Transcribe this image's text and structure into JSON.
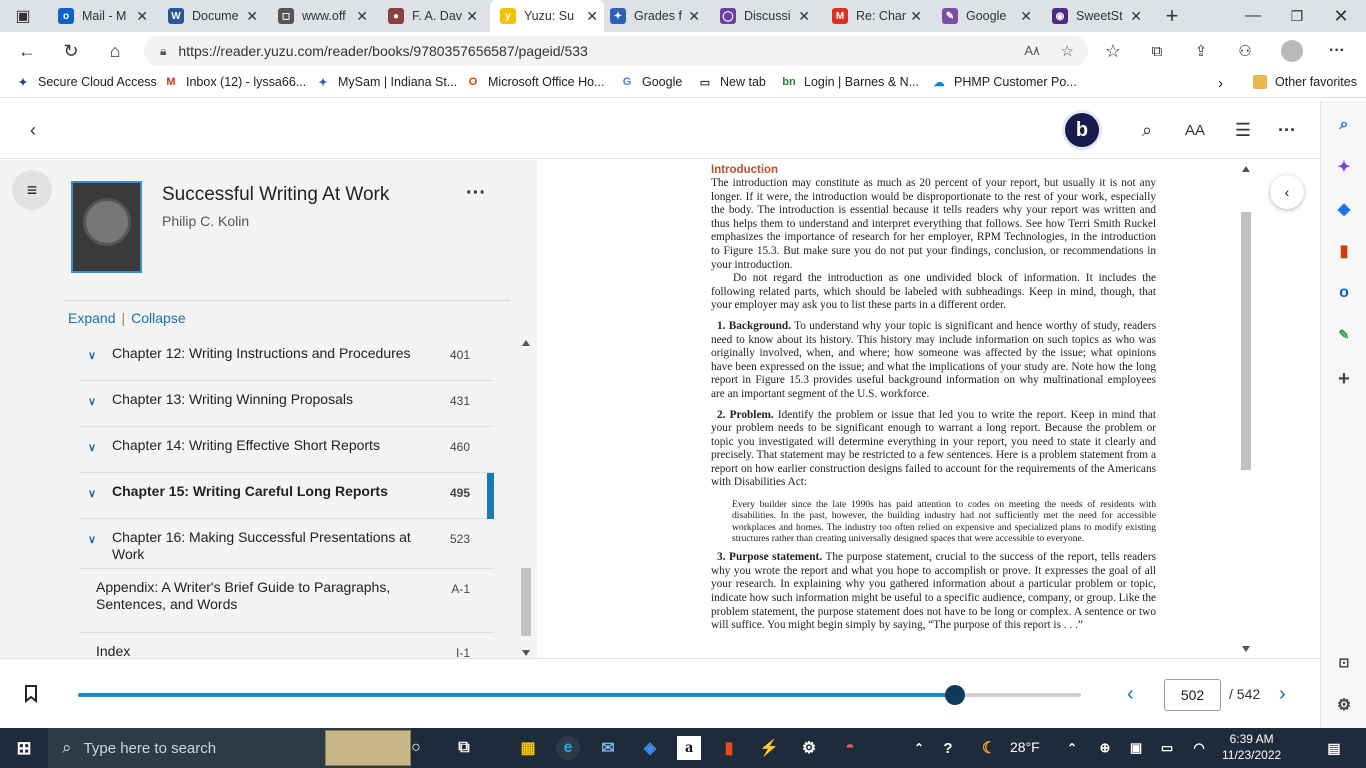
{
  "browser": {
    "tabs": [
      {
        "title": "Mail - M",
        "icon": "outlook-icon",
        "color": "#0a64c8",
        "glyph": "o"
      },
      {
        "title": "Docume",
        "icon": "word-icon",
        "color": "#2b5797",
        "glyph": "W"
      },
      {
        "title": "www.off",
        "icon": "page-icon",
        "color": "#555555",
        "glyph": "◻"
      },
      {
        "title": "F. A. Dav",
        "icon": "globe-icon",
        "color": "#8a3f3f",
        "glyph": "●"
      },
      {
        "title": "Yuzu: Su",
        "icon": "yuzu-icon",
        "color": "#f2c200",
        "glyph": "y"
      },
      {
        "title": "Grades f",
        "icon": "star-icon",
        "color": "#2e5fb8",
        "glyph": "✦"
      },
      {
        "title": "Discussi",
        "icon": "circle-icon",
        "color": "#6b3fa0",
        "glyph": "◯"
      },
      {
        "title": "Re: Char",
        "icon": "gmail-icon",
        "color": "#d93025",
        "glyph": "M"
      },
      {
        "title": "Google",
        "icon": "pen-icon",
        "color": "#7b4ea6",
        "glyph": "✎"
      },
      {
        "title": "SweetSt",
        "icon": "swirl-icon",
        "color": "#4b2a86",
        "glyph": "◉"
      }
    ],
    "active_tab_index": 4,
    "url": "https://reader.yuzu.com/reader/books/9780357656587/pageid/533",
    "favorites": [
      {
        "label": "Secure Cloud Access",
        "icon": "star-icon",
        "color": "#2e3d80",
        "glyph": "✦"
      },
      {
        "label": "Inbox (12) - lyssa66...",
        "icon": "gmail-icon",
        "color": "#d93025",
        "glyph": "M"
      },
      {
        "label": "MySam | Indiana St...",
        "icon": "star-icon",
        "color": "#2e5fb8",
        "glyph": "✦"
      },
      {
        "label": "Microsoft Office Ho...",
        "icon": "office-icon",
        "color": "#d83b01",
        "glyph": "O"
      },
      {
        "label": "Google",
        "icon": "google-icon",
        "color": "#4285f4",
        "glyph": "G"
      },
      {
        "label": "New tab",
        "icon": "newtab-icon",
        "color": "#333333",
        "glyph": "▭"
      },
      {
        "label": "Login | Barnes & N...",
        "icon": "bn-icon",
        "color": "#2e7d32",
        "glyph": "bn"
      },
      {
        "label": "PHMP Customer Po...",
        "icon": "cloud-icon",
        "color": "#0a84d8",
        "glyph": "☁"
      }
    ],
    "other_favorites": "Other favorites"
  },
  "reader": {
    "book": {
      "title": "Successful Writing At Work",
      "author": "Philip C. Kolin"
    },
    "expand_label": "Expand",
    "collapse_label": "Collapse",
    "toc": [
      {
        "label": "Chapter 12: Writing Instructions and Procedures",
        "page": "401",
        "chevron": true,
        "current": false
      },
      {
        "label": "Chapter 13: Writing Winning Proposals",
        "page": "431",
        "chevron": true,
        "current": false
      },
      {
        "label": "Chapter 14: Writing Effective Short Reports",
        "page": "460",
        "chevron": true,
        "current": false
      },
      {
        "label": "Chapter 15: Writing Careful Long Reports",
        "page": "495",
        "chevron": true,
        "current": true
      },
      {
        "label": "Chapter 16: Making Successful Presentations at Work",
        "page": "523",
        "chevron": true,
        "current": false
      },
      {
        "label": "Appendix: A Writer's Brief Guide to Paragraphs, Sentences, and Words",
        "page": "A-1",
        "chevron": false,
        "current": false
      },
      {
        "label": "Index",
        "page": "I-1",
        "chevron": false,
        "current": false
      }
    ],
    "article": {
      "heading": "Introduction",
      "p1": "The introduction may constitute as much as 20 percent of your report, but usually it is not any longer. If it were, the introduction would be disproportionate to the rest of your work, especially the body. The introduction is essential because it tells readers why your report was written and thus helps them to understand and interpret everything that follows. See how Terri Smith Ruckel emphasizes the importance of research for her employer, RPM Technologies, in the introduction to Figure 15.3. But make sure you do not put your findings, conclusion, or recommendations in your introduction.",
      "p2": "Do not regard the introduction as one undivided block of information. It includes the following related parts, which should be labeled with subheadings. Keep in mind, though, that your employer may ask you to list these parts in a different order.",
      "items": [
        {
          "lead": "1. Background.",
          "text": " To understand why your topic is significant and hence worthy of study, readers need to know about its history. This history may include information on such topics as who was originally involved, when, and where; how someone was affected by the issue; what opinions have been expressed on the issue; and what the implications of your study are. Note how the long report in Figure 15.3 provides useful background information on why multinational employees are an important segment of the U.S. workforce."
        },
        {
          "lead": "2. Problem.",
          "text": " Identify the problem or issue that led you to write the report. Keep in mind that your problem needs to be significant enough to warrant a long report. Because the problem or topic you investigated will determine everything in your report, you need to state it clearly and precisely. That statement may be restricted to a few sentences. Here is a problem statement from a report on how earlier construction designs failed to account for the requirements of the Americans with Disabilities Act:"
        }
      ],
      "quote": "Every builder since the late 1990s has paid attention to codes on meeting the needs of residents with disabilities. In the past, however, the building industry had not sufficiently met the need for accessible workplaces and homes. The industry too often relied on expensive and specialized plans to modify existing structures rather than creating universally designed spaces that were accessible to everyone.",
      "item3_lead": "3. Purpose statement.",
      "item3_text": " The purpose statement, crucial to the success of the report, tells readers why you wrote the report and what you hope to accomplish or prove. It expresses the goal of all your research. In explaining why you gathered information about a particular problem or topic, indicate how such information might be useful to a specific audience, company, or group. Like the problem statement, the purpose statement does not have to be long or complex. A sentence or two will suffice. You might begin simply by saying, “The purpose of this report is . . .”"
    },
    "pagination": {
      "current_page": "502",
      "total": "/ 542",
      "progress_fraction": 0.874
    }
  },
  "taskbar": {
    "search_placeholder": "Type here to search",
    "weather": "28°F",
    "time": "6:39 AM",
    "date": "11/23/2022"
  },
  "colors": {
    "accent": "#1a8ac8",
    "link": "#1a6fb0",
    "heading": "#c0502a"
  }
}
